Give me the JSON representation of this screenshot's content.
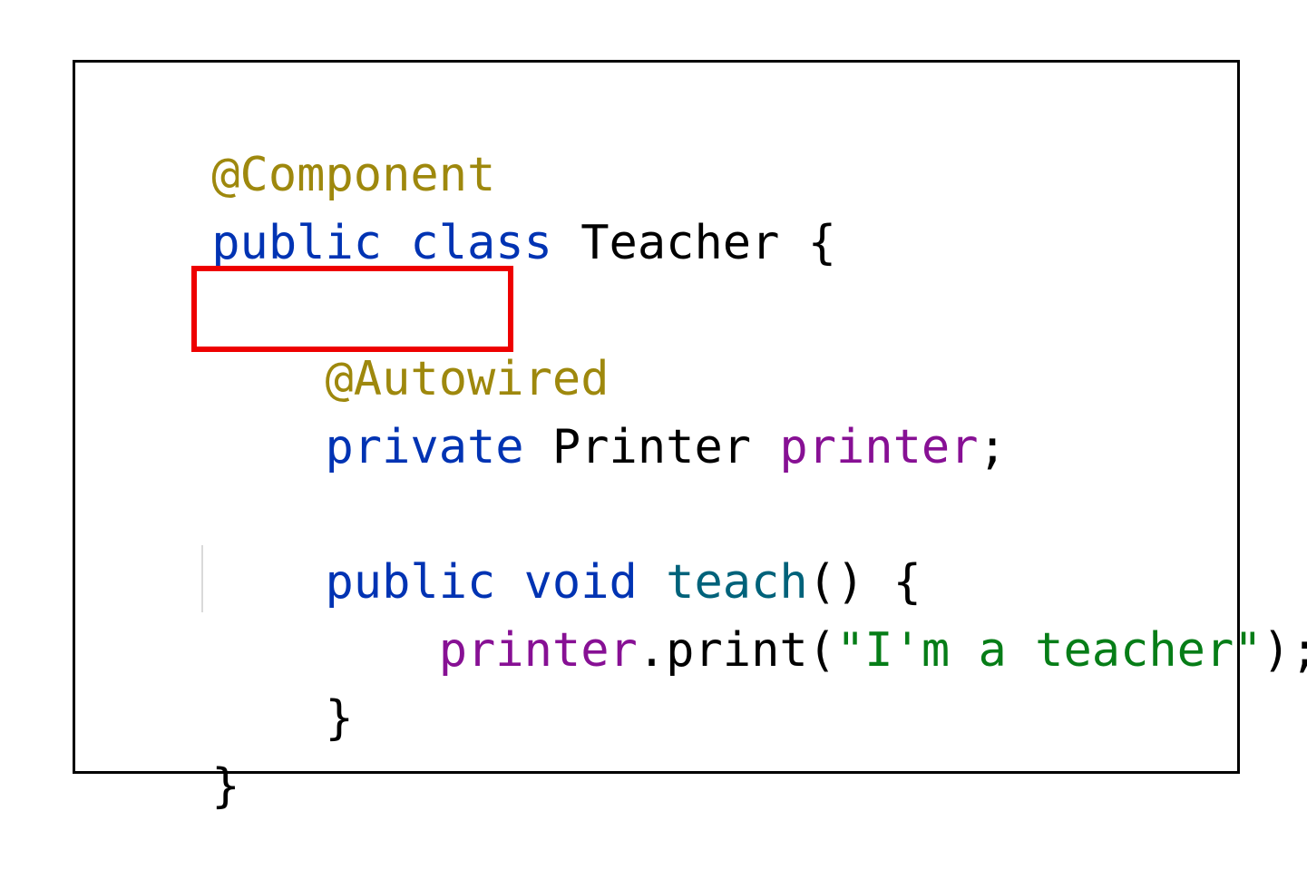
{
  "code": {
    "lines": [
      [
        {
          "text": "@Component",
          "kind": "annotation"
        }
      ],
      [
        {
          "text": "public",
          "kind": "keyword"
        },
        {
          "text": " ",
          "kind": "plain"
        },
        {
          "text": "class",
          "kind": "keyword"
        },
        {
          "text": " Teacher {",
          "kind": "plain"
        }
      ],
      [],
      [
        {
          "text": "    ",
          "kind": "plain"
        },
        {
          "text": "@Autowired",
          "kind": "annotation"
        }
      ],
      [
        {
          "text": "    ",
          "kind": "plain"
        },
        {
          "text": "private",
          "kind": "keyword"
        },
        {
          "text": " Printer ",
          "kind": "plain"
        },
        {
          "text": "printer",
          "kind": "field"
        },
        {
          "text": ";",
          "kind": "plain"
        }
      ],
      [],
      [
        {
          "text": "    ",
          "kind": "plain"
        },
        {
          "text": "public",
          "kind": "keyword"
        },
        {
          "text": " ",
          "kind": "plain"
        },
        {
          "text": "void",
          "kind": "keyword"
        },
        {
          "text": " ",
          "kind": "plain"
        },
        {
          "text": "teach",
          "kind": "method"
        },
        {
          "text": "() {",
          "kind": "plain"
        }
      ],
      [
        {
          "text": "        ",
          "kind": "plain"
        },
        {
          "text": "printer",
          "kind": "field"
        },
        {
          "text": ".print(",
          "kind": "plain"
        },
        {
          "text": "\"I'm a teacher\"",
          "kind": "string"
        },
        {
          "text": ");",
          "kind": "plain"
        }
      ],
      [
        {
          "text": "    }",
          "kind": "plain"
        }
      ],
      [
        {
          "text": "}",
          "kind": "plain"
        }
      ]
    ],
    "highlighted_token": "@Autowired"
  },
  "colors": {
    "annotation": "#9e880d",
    "keyword": "#0033b3",
    "field": "#871094",
    "method": "#00627a",
    "string": "#067d17",
    "plain": "#000000",
    "highlight": "#ee0000"
  }
}
